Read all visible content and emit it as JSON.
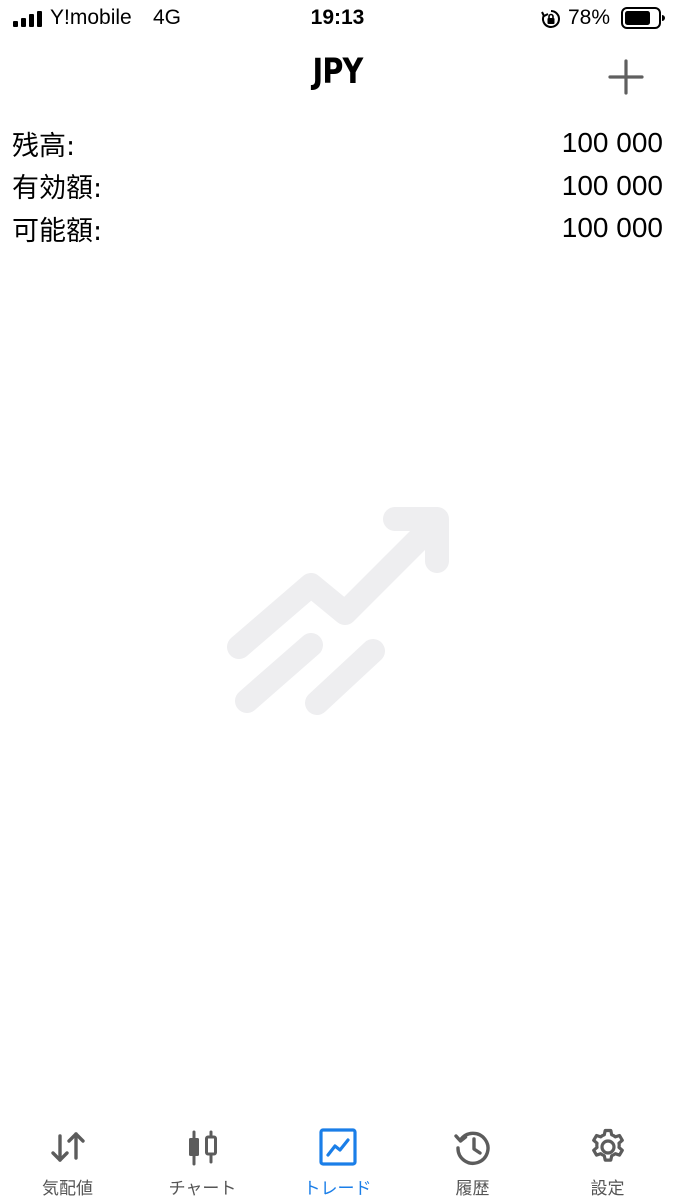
{
  "status_bar": {
    "carrier": "Y!mobile",
    "network": "4G",
    "time": "19:13",
    "battery": "78%",
    "battery_level": 0.78
  },
  "header": {
    "title": "JPY",
    "add_icon": "plus-icon"
  },
  "account": {
    "rows": [
      {
        "label": "残高:",
        "value": "100 000"
      },
      {
        "label": "有効額:",
        "value": "100 000"
      },
      {
        "label": "可能額:",
        "value": "100 000"
      }
    ]
  },
  "empty_state": {
    "icon": "trending-up-icon",
    "color": "#eeeef0"
  },
  "tabs": [
    {
      "label": "気配値",
      "icon": "quotes-arrows-icon",
      "active": false
    },
    {
      "label": "チャート",
      "icon": "candlestick-icon",
      "active": false
    },
    {
      "label": "トレード",
      "icon": "trade-chart-icon",
      "active": true
    },
    {
      "label": "履歴",
      "icon": "history-icon",
      "active": false
    },
    {
      "label": "設定",
      "icon": "gear-icon",
      "active": false
    }
  ],
  "colors": {
    "accent": "#1a7ee8",
    "inactive_tab": "#555555"
  }
}
